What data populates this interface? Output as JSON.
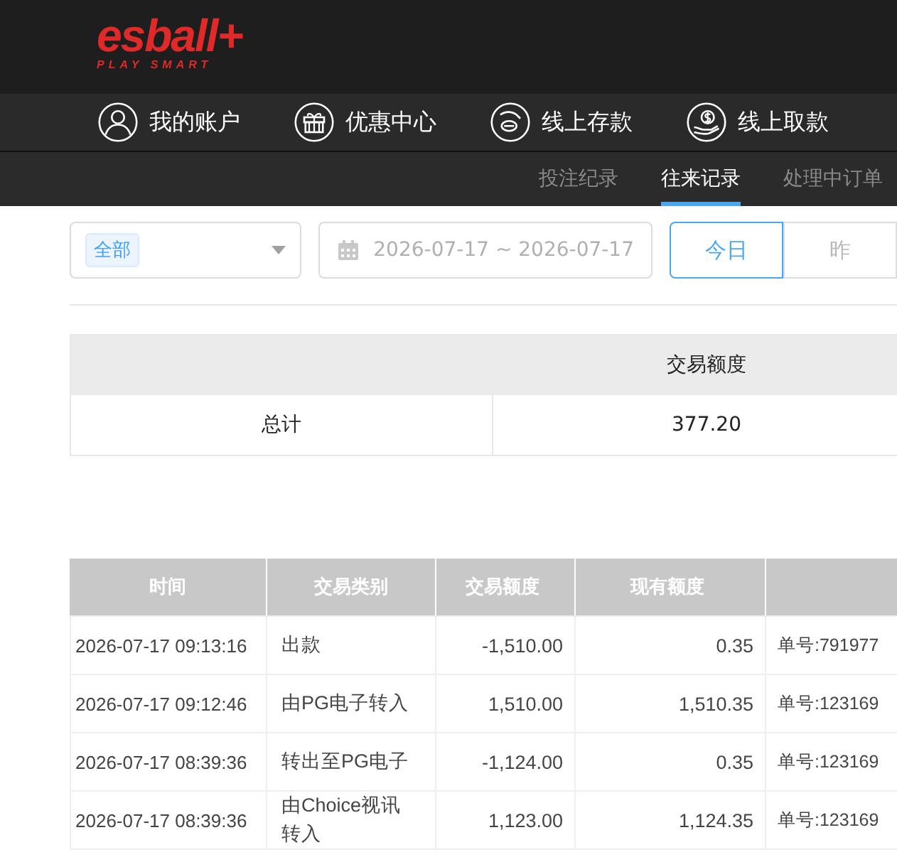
{
  "header": {
    "logo": "esball+",
    "tagline": "PLAY SMART"
  },
  "nav": [
    {
      "label": "我的账户"
    },
    {
      "label": "优惠中心"
    },
    {
      "label": "线上存款"
    },
    {
      "label": "线上取款"
    }
  ],
  "subnav": [
    {
      "label": "投注纪录",
      "selected": false
    },
    {
      "label": "往来记录",
      "selected": true
    },
    {
      "label": "处理中订单",
      "selected": false
    }
  ],
  "filters": {
    "category_tag": "全部",
    "date_range": "2026-07-17 ~ 2026-07-17",
    "quick_dates": [
      {
        "label": "今日",
        "selected": true
      },
      {
        "label": "昨",
        "selected": false
      }
    ]
  },
  "summary": {
    "column": "交易额度",
    "rows": [
      {
        "label": "总计",
        "value": "377.20"
      }
    ]
  },
  "transactions": {
    "columns": [
      "时间",
      "交易类别",
      "交易额度",
      "现有额度"
    ],
    "rows": [
      {
        "time": "2026-07-17 09:13:16",
        "type": "出款",
        "amount": "-1,510.00",
        "balance": "0.35",
        "note": "单号:791977"
      },
      {
        "time": "2026-07-17 09:12:46",
        "type": "由PG电子转入",
        "amount": "1,510.00",
        "balance": "1,510.35",
        "note": "单号:123169"
      },
      {
        "time": "2026-07-17 08:39:36",
        "type": "转出至PG电子",
        "amount": "-1,124.00",
        "balance": "0.35",
        "note": "单号:123169"
      },
      {
        "time": "2026-07-17 08:39:36",
        "type": "由Choice视讯转入",
        "amount": "1,123.00",
        "balance": "1,124.35",
        "note": "单号:123169"
      }
    ]
  }
}
